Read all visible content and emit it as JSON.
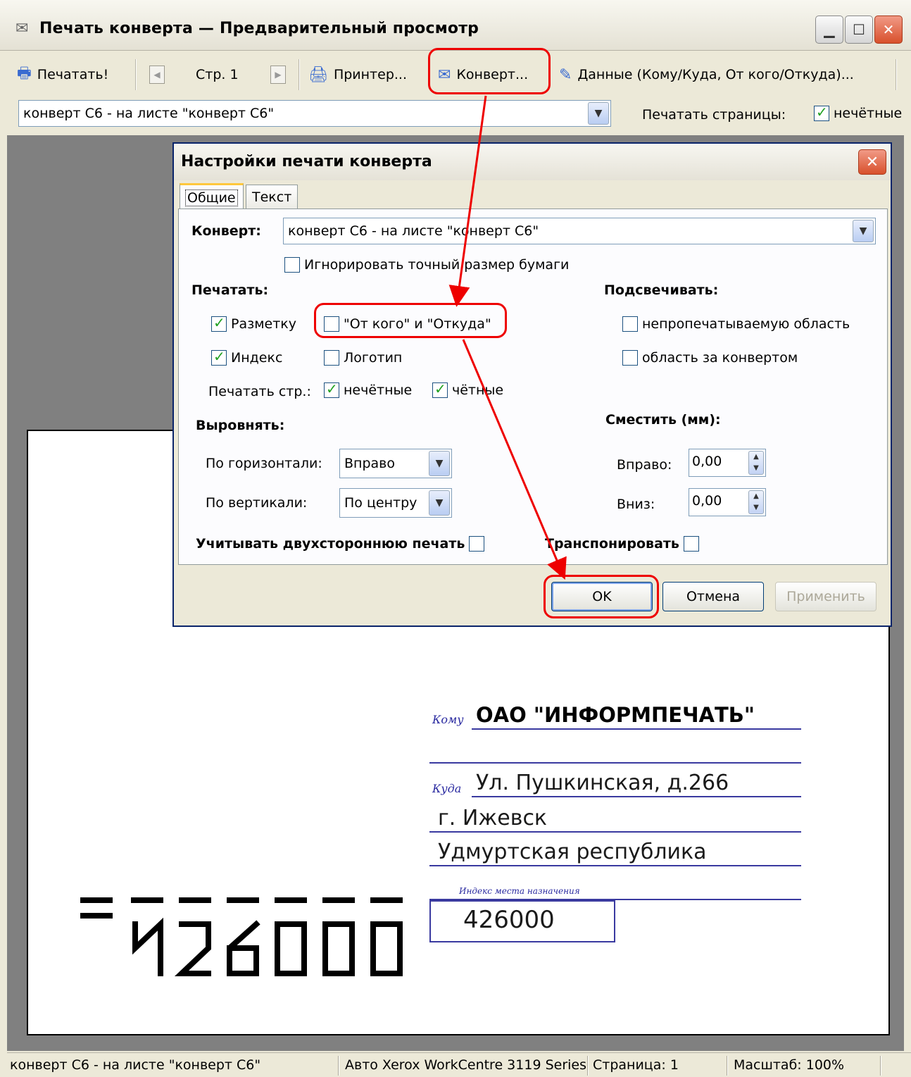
{
  "window": {
    "title": "Печать конверта — Предварительный просмотр"
  },
  "toolbar": {
    "print_label": "Печатать!",
    "page_label": "Стр. 1",
    "printer_label": "Принтер...",
    "envelope_label": "Конверт...",
    "data_label": "Данные (Кому/Куда, От кого/Откуда)..."
  },
  "row2": {
    "envelope_select": "конверт С6 - на листе \"конверт С6\"",
    "print_pages_label": "Печатать страницы:",
    "odd_label": "нечётные"
  },
  "dialog": {
    "title": "Настройки печати конверта",
    "tabs": [
      "Общие",
      "Текст"
    ],
    "envelope_label": "Конверт:",
    "envelope_value": "конверт С6 - на листе \"конверт С6\"",
    "ignore_size_label": "Игнорировать точный размер бумаги",
    "print_heading": "Печатать:",
    "markup_label": "Разметку",
    "from_label": "\"От кого\" и \"Откуда\"",
    "index_label": "Индекс",
    "logo_label": "Логотип",
    "print_pages_label": "Печатать стр.:",
    "odd_label": "нечётные",
    "even_label": "чётные",
    "highlight_heading": "Подсвечивать:",
    "nonprint_label": "непропечатываемую область",
    "outside_label": "область за конвертом",
    "align_heading": "Выровнять:",
    "horiz_label": "По горизонтали:",
    "horiz_value": "Вправо",
    "vert_label": "По вертикали:",
    "vert_value": "По центру",
    "shift_heading": "Сместить (мм):",
    "right_label": "Вправо:",
    "right_value": "0,00",
    "down_label": "Вниз:",
    "down_value": "0,00",
    "duplex_label": "Учитывать двухстороннюю печать",
    "transpose_label": "Транспонировать",
    "ok_label": "OK",
    "cancel_label": "Отмена",
    "apply_label": "Применить"
  },
  "envelope": {
    "to_label": "Кому",
    "to_value": "ОАО \"ИНФОРМПЕЧАТЬ\"",
    "where_label": "Куда",
    "line1": "Ул. Пушкинская, д.266",
    "line2": "г. Ижевск",
    "line3": "Удмуртская республика",
    "index_caption": "Индекс места назначения",
    "index_value": "426000"
  },
  "status": {
    "envelope": "конверт С6 - на листе \"конверт С6\"",
    "printer": "Авто Xerox WorkCentre 3119 Series",
    "page": "Страница: 1",
    "zoom": "Масштаб: 100%"
  }
}
